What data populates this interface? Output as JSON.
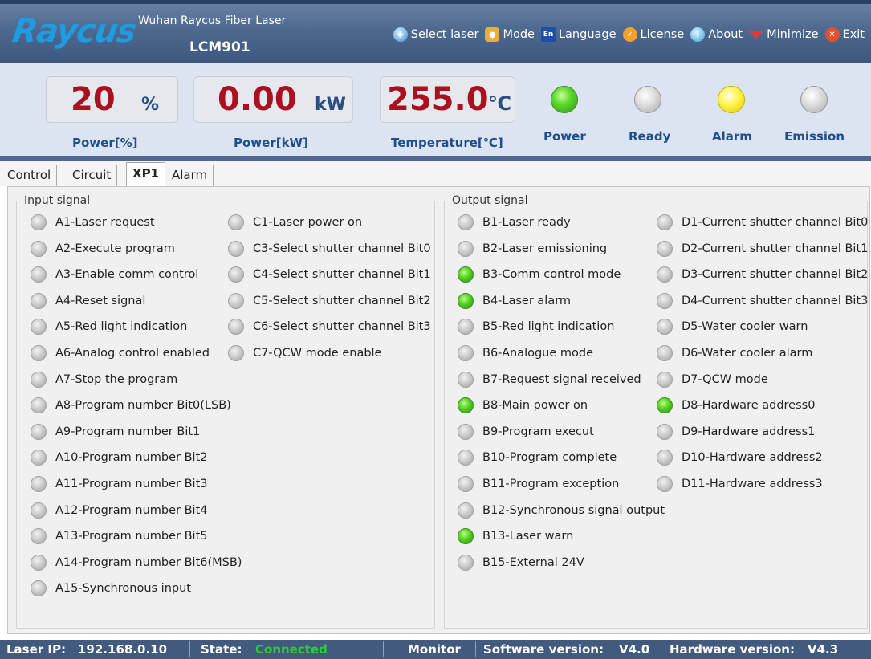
{
  "header": {
    "logo": "Raycus",
    "company": "Wuhan Raycus Fiber Laser",
    "model": "LCM901",
    "menu": [
      {
        "label": "Select laser",
        "icon": "globe-icon"
      },
      {
        "label": "Mode",
        "icon": "users-icon"
      },
      {
        "label": "Language",
        "icon": "en-icon"
      },
      {
        "label": "License",
        "icon": "check-icon"
      },
      {
        "label": "About",
        "icon": "info-icon"
      },
      {
        "label": "Minimize",
        "icon": "minimize-icon"
      },
      {
        "label": "Exit",
        "icon": "close-icon"
      }
    ]
  },
  "readouts": {
    "power_pct": {
      "value": "20",
      "unit": "%",
      "label": "Power[%]"
    },
    "power_kw": {
      "value": "0.00",
      "unit": "kW",
      "label": "Power[kW]"
    },
    "temperature": {
      "value": "255.0",
      "unit": "℃",
      "label": "Temperature[℃]"
    }
  },
  "status_leds": [
    {
      "label": "Power",
      "state": "green"
    },
    {
      "label": "Ready",
      "state": "off"
    },
    {
      "label": "Alarm",
      "state": "yellow"
    },
    {
      "label": "Emission",
      "state": "off"
    }
  ],
  "tabs": [
    {
      "label": "Control",
      "active": false
    },
    {
      "label": "Circuit",
      "active": false
    },
    {
      "label": "XP1",
      "active": true
    },
    {
      "label": "Alarm",
      "active": false
    }
  ],
  "input_group": {
    "title": "Input signal",
    "col1": [
      {
        "label": "A1-Laser request",
        "on": false
      },
      {
        "label": "A2-Execute program",
        "on": false
      },
      {
        "label": "A3-Enable comm control",
        "on": false
      },
      {
        "label": "A4-Reset signal",
        "on": false
      },
      {
        "label": "A5-Red light indication",
        "on": false
      },
      {
        "label": "A6-Analog control enabled",
        "on": false
      },
      {
        "label": "A7-Stop the program",
        "on": false
      },
      {
        "label": "A8-Program number Bit0(LSB)",
        "on": false
      },
      {
        "label": "A9-Program number Bit1",
        "on": false
      },
      {
        "label": "A10-Program number Bit2",
        "on": false
      },
      {
        "label": "A11-Program number Bit3",
        "on": false
      },
      {
        "label": "A12-Program number Bit4",
        "on": false
      },
      {
        "label": "A13-Program number Bit5",
        "on": false
      },
      {
        "label": "A14-Program number Bit6(MSB)",
        "on": false
      },
      {
        "label": "A15-Synchronous input",
        "on": false
      }
    ],
    "col2": [
      {
        "label": "C1-Laser power on",
        "on": false
      },
      {
        "label": "C3-Select shutter channel Bit0",
        "on": false
      },
      {
        "label": "C4-Select shutter channel Bit1",
        "on": false
      },
      {
        "label": "C5-Select shutter channel Bit2",
        "on": false
      },
      {
        "label": "C6-Select shutter channel Bit3",
        "on": false
      },
      {
        "label": "C7-QCW mode enable",
        "on": false
      }
    ]
  },
  "output_group": {
    "title": "Output signal",
    "col1": [
      {
        "label": "B1-Laser ready",
        "on": false
      },
      {
        "label": "B2-Laser emissioning",
        "on": false
      },
      {
        "label": "B3-Comm control mode",
        "on": true
      },
      {
        "label": "B4-Laser alarm",
        "on": true
      },
      {
        "label": "B5-Red light indication",
        "on": false
      },
      {
        "label": "B6-Analogue mode",
        "on": false
      },
      {
        "label": "B7-Request signal received",
        "on": false
      },
      {
        "label": "B8-Main power on",
        "on": true
      },
      {
        "label": "B9-Program execut",
        "on": false
      },
      {
        "label": "B10-Program complete",
        "on": false
      },
      {
        "label": "B11-Program exception",
        "on": false
      },
      {
        "label": "B12-Synchronous signal output",
        "on": false
      },
      {
        "label": "B13-Laser warn",
        "on": true
      },
      {
        "label": "B15-External 24V",
        "on": false
      }
    ],
    "col2": [
      {
        "label": "D1-Current shutter channel Bit0",
        "on": false
      },
      {
        "label": "D2-Current shutter channel Bit1",
        "on": false
      },
      {
        "label": "D3-Current shutter channel Bit2",
        "on": false
      },
      {
        "label": "D4-Current shutter channel Bit3",
        "on": false
      },
      {
        "label": "D5-Water cooler warn",
        "on": false
      },
      {
        "label": "D6-Water cooler alarm",
        "on": false
      },
      {
        "label": "D7-QCW mode",
        "on": false
      },
      {
        "label": "D8-Hardware address0",
        "on": true
      },
      {
        "label": "D9-Hardware address1",
        "on": false
      },
      {
        "label": "D10-Hardware address2",
        "on": false
      },
      {
        "label": "D11-Hardware address3",
        "on": false
      }
    ]
  },
  "statusbar": {
    "ip_label": "Laser IP:",
    "ip_value": "192.168.0.10",
    "state_label": "State:",
    "state_value": "Connected",
    "monitor": "Monitor",
    "sw_label": "Software version:",
    "sw_value": "V4.0",
    "hw_label": "Hardware version:",
    "hw_value": "V4.3"
  },
  "colors": {
    "connected": "#2ecc3a",
    "value_red": "#aa1120",
    "label_blue": "#1f4f8f"
  }
}
